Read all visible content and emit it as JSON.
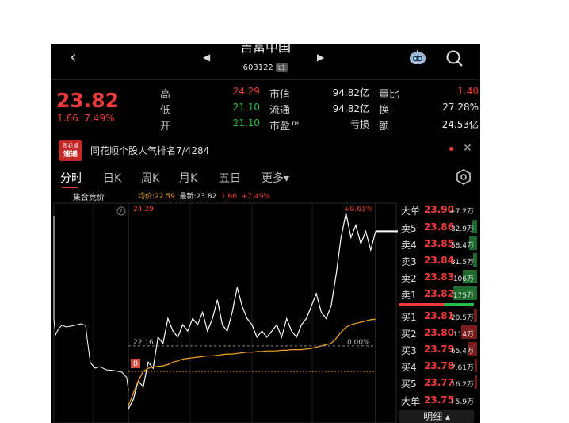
{
  "header": {
    "title": "吉富中国",
    "code": "603122",
    "level_badge": "L1"
  },
  "quote": {
    "price": "23.82",
    "change": "1.66",
    "change_pct": "7.49%"
  },
  "stats": [
    {
      "label": "高",
      "value": "24.29",
      "label2": "市值",
      "value2": "94.82亿",
      "label3": "量比",
      "value3": "1.40"
    },
    {
      "label": "低",
      "value": "21.10",
      "label2": "流通",
      "value2": "94.82亿",
      "label3": "换",
      "value3": "27.28%"
    },
    {
      "label": "开",
      "value": "21.10",
      "label2": "市盈™",
      "value2": "亏损",
      "label3": "额",
      "value3": "24.53亿"
    }
  ],
  "ad": {
    "logo_line1": "同花顺",
    "logo_line2": "速递",
    "text": "同花顺个股人气排名7/4284"
  },
  "tabs": [
    "分时",
    "日K",
    "周K",
    "月K",
    "五日",
    "更多▾"
  ],
  "chart_info": {
    "auction_label": "集合竞价",
    "avg_label": "均价:22.59",
    "latest_label": "最新:23.82",
    "chg_label": "1.66",
    "pct_label": "+7.49%",
    "high_label": "24.29",
    "pre_close_label": "22.16",
    "zero_pct_label": "0.00%",
    "max_pct_label": "+9.61%",
    "buy_marker": "B",
    "help_icon_text": "?"
  },
  "chart_data": {
    "type": "line",
    "y_range": [
      21.0,
      24.4
    ],
    "pre_close": 22.16,
    "series": [
      {
        "values": [
          21.15,
          21.3,
          21.6,
          21.5,
          21.9,
          21.8,
          22.3,
          22.2,
          22.6,
          22.4,
          22.3,
          22.5,
          22.4,
          22.6,
          22.5,
          22.7,
          22.4,
          22.6,
          22.9,
          22.5,
          22.4,
          22.7,
          23.1,
          22.8,
          22.6,
          22.5,
          22.3,
          22.4,
          22.3,
          22.4,
          22.5,
          22.3,
          22.6,
          22.4,
          22.3,
          22.5,
          22.6,
          22.8,
          23.0,
          22.7,
          22.6,
          22.8,
          23.3,
          23.9,
          24.29,
          23.9,
          24.1,
          23.8,
          24.0,
          23.7,
          24.0
        ]
      },
      {
        "values": [
          21.2,
          21.4,
          21.6,
          21.75,
          21.8,
          21.82,
          21.83,
          21.84,
          21.86,
          21.9,
          21.92,
          21.95,
          21.96,
          21.97,
          21.98,
          21.99,
          22.0,
          22.0,
          22.01,
          22.02,
          22.03,
          22.03,
          22.04,
          22.05,
          22.06,
          22.06,
          22.07,
          22.07,
          22.08,
          22.08,
          22.08,
          22.09,
          22.09,
          22.1,
          22.1,
          22.1,
          22.11,
          22.12,
          22.14,
          22.16,
          22.18,
          22.2,
          22.28,
          22.38,
          22.46,
          22.5,
          22.52,
          22.54,
          22.56,
          22.58,
          22.59
        ]
      }
    ]
  },
  "order_book": {
    "top_sell": {
      "label": "大单",
      "price": "23.90",
      "vol": "+7.2万"
    },
    "sells": [
      {
        "label": "卖5",
        "price": "23.86",
        "vol": "32.9万",
        "ratio": 0.19
      },
      {
        "label": "卖4",
        "price": "23.85",
        "vol": "58.4万",
        "ratio": 0.33
      },
      {
        "label": "卖3",
        "price": "23.84",
        "vol": "31.5万",
        "ratio": 0.18
      },
      {
        "label": "卖2",
        "price": "23.83",
        "vol": "106万",
        "ratio": 0.61
      },
      {
        "label": "卖1",
        "price": "23.82",
        "vol": "175万",
        "ratio": 1.0
      }
    ],
    "buys": [
      {
        "label": "买1",
        "price": "23.81",
        "vol": "20.5万",
        "ratio": 0.12
      },
      {
        "label": "买2",
        "price": "23.80",
        "vol": "114万",
        "ratio": 0.65
      },
      {
        "label": "买3",
        "price": "23.79",
        "vol": "65.4万",
        "ratio": 0.37
      },
      {
        "label": "买4",
        "price": "23.78",
        "vol": "7.61万",
        "ratio": 0.05
      },
      {
        "label": "买5",
        "price": "23.77",
        "vol": "16.2万",
        "ratio": 0.09
      }
    ],
    "top_buy": {
      "label": "大单",
      "price": "23.75",
      "vol": "+5.9万"
    },
    "detail_label": "明细 ▴"
  },
  "colors": {
    "up": "#f03a3a",
    "down": "#23c042",
    "avg": "#f5a623",
    "bg": "#000000"
  }
}
